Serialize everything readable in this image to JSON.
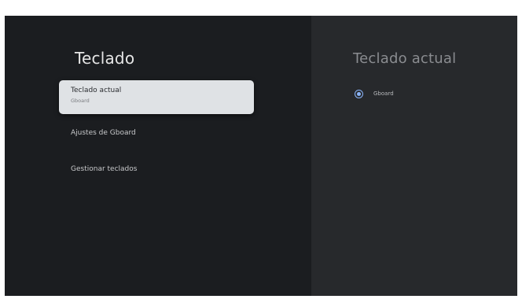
{
  "left": {
    "title": "Teclado",
    "items": [
      {
        "title": "Teclado actual",
        "subtitle": "Gboard",
        "focused": true
      },
      {
        "title": "Ajustes de Gboard"
      },
      {
        "title": "Gestionar teclados"
      }
    ]
  },
  "right": {
    "title": "Teclado actual",
    "options": [
      {
        "label": "Gboard",
        "selected": true
      }
    ]
  },
  "colors": {
    "accent": "#8ab4f8",
    "background": "#1b1d20",
    "focus_card": "#dfe2e5"
  }
}
